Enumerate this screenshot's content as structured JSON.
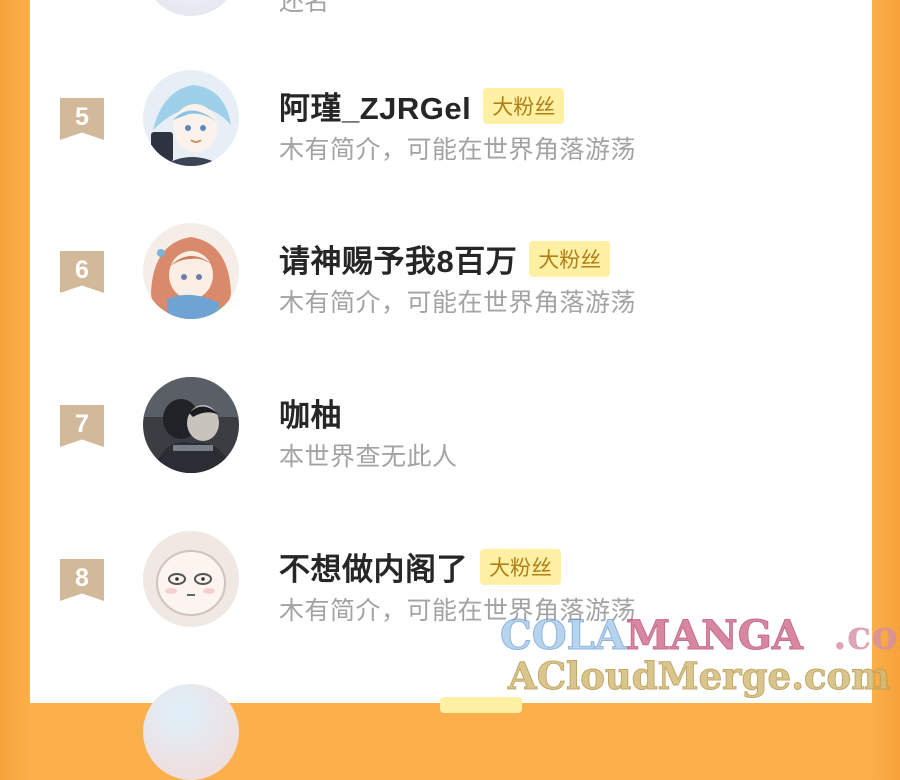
{
  "list": {
    "top_partial_text": "还名",
    "items": [
      {
        "rank": "5",
        "name": "阿瑾_ZJRGel",
        "badge": "大粉丝",
        "bio": "木有简介，可能在世界角落游荡"
      },
      {
        "rank": "6",
        "name": "请神赐予我8百万",
        "badge": "大粉丝",
        "bio": "木有简介，可能在世界角落游荡"
      },
      {
        "rank": "7",
        "name": "咖柚",
        "badge": "",
        "bio": "本世界查无此人"
      },
      {
        "rank": "8",
        "name": "不想做内阁了",
        "badge": "大粉丝",
        "bio": "木有简介，可能在世界角落游荡"
      }
    ]
  },
  "watermark": {
    "line1_a": "COLA",
    "line1_b": "MANGA",
    "line1_c": ".com",
    "line2": "ACloudMerge.com"
  },
  "colors": {
    "background_orange": "#fbb04c",
    "rank_ribbon": "#d2b99a",
    "badge_bg": "#fff0a3",
    "badge_text": "#b07f1a",
    "bio_text": "#a3a3a3",
    "name_text": "#262626"
  }
}
